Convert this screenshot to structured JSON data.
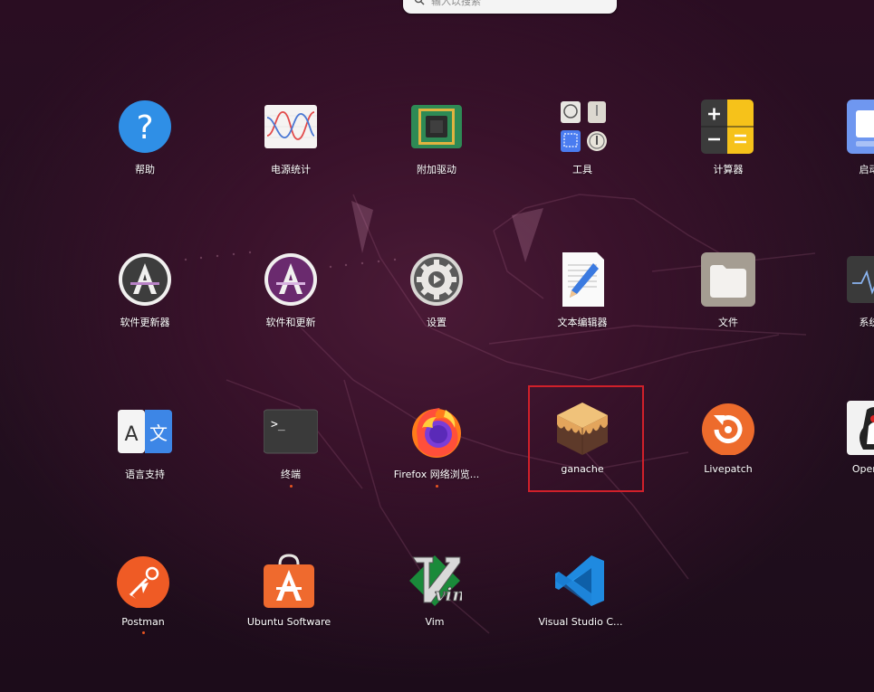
{
  "search": {
    "placeholder": "输入以搜索"
  },
  "apps": [
    {
      "label": "帮助",
      "icon": "help-icon",
      "running": false
    },
    {
      "label": "电源统计",
      "icon": "power-statistics-icon",
      "running": false
    },
    {
      "label": "附加驱动",
      "icon": "additional-drivers-icon",
      "running": false
    },
    {
      "label": "工具",
      "icon": "utilities-folder-icon",
      "running": false
    },
    {
      "label": "计算器",
      "icon": "calculator-icon",
      "running": false
    },
    {
      "label": "启动应",
      "icon": "startup-applications-icon",
      "running": false
    },
    {
      "label": "软件更新器",
      "icon": "software-updater-icon",
      "running": false
    },
    {
      "label": "软件和更新",
      "icon": "software-and-updates-icon",
      "running": false
    },
    {
      "label": "设置",
      "icon": "settings-icon",
      "running": false
    },
    {
      "label": "文本编辑器",
      "icon": "text-editor-icon",
      "running": false
    },
    {
      "label": "文件",
      "icon": "files-icon",
      "running": false
    },
    {
      "label": "系统监",
      "icon": "system-monitor-icon",
      "running": false
    },
    {
      "label": "语言支持",
      "icon": "language-support-icon",
      "running": false
    },
    {
      "label": "终端",
      "icon": "terminal-icon",
      "running": true
    },
    {
      "label": "Firefox 网络浏览...",
      "icon": "firefox-icon",
      "running": true
    },
    {
      "label": "ganache",
      "icon": "ganache-icon",
      "running": false,
      "highlighted": true
    },
    {
      "label": "Livepatch",
      "icon": "livepatch-icon",
      "running": false
    },
    {
      "label": "OpenJDK",
      "icon": "openjdk-icon",
      "running": false
    },
    {
      "label": "Postman",
      "icon": "postman-icon",
      "running": true
    },
    {
      "label": "Ubuntu Software",
      "icon": "ubuntu-software-icon",
      "running": false
    },
    {
      "label": "Vim",
      "icon": "vim-icon",
      "running": false
    },
    {
      "label": "Visual Studio C...",
      "icon": "vscode-icon",
      "running": false
    }
  ],
  "colors": {
    "accent": "#e95420",
    "highlight_border": "#d0202a"
  }
}
